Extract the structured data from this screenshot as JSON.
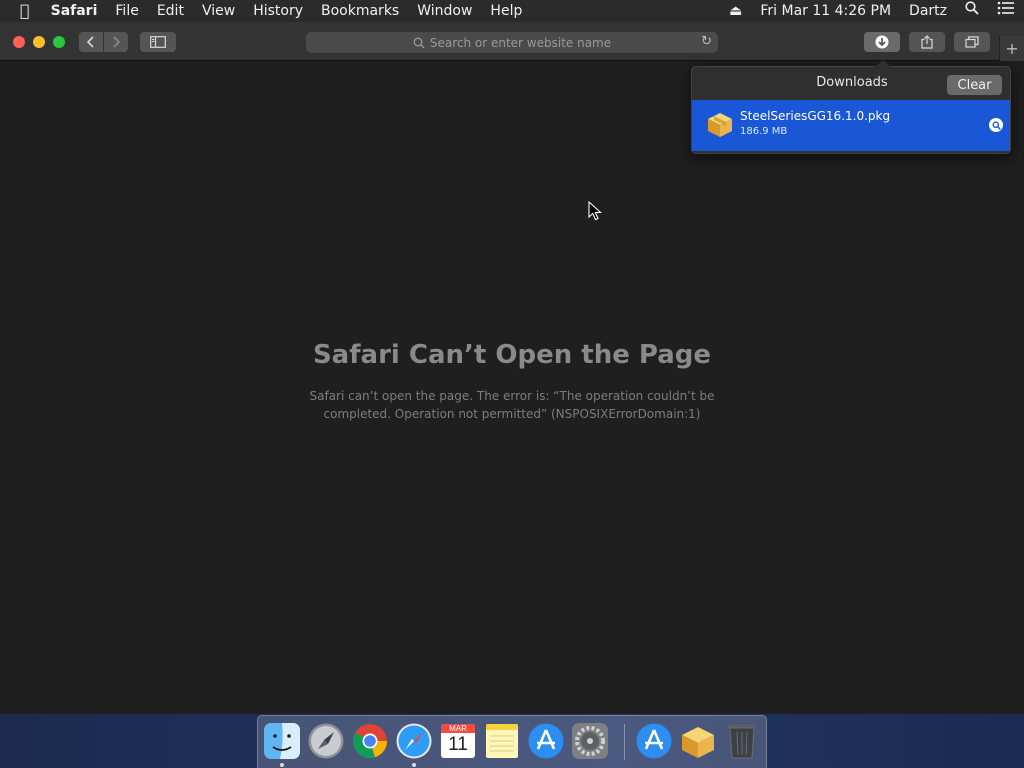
{
  "menubar": {
    "apple": "",
    "app": "Safari",
    "items": [
      "File",
      "Edit",
      "View",
      "History",
      "Bookmarks",
      "Window",
      "Help"
    ],
    "datetime": "Fri Mar 11  4:26 PM",
    "user": "Dartz"
  },
  "toolbar": {
    "address_placeholder": "Search or enter website name"
  },
  "error": {
    "title": "Safari Can’t Open the Page",
    "message": "Safari can’t open the page. The error is: “The operation couldn’t be completed. Operation not permitted” (NSPOSIXErrorDomain:1)"
  },
  "downloads": {
    "title": "Downloads",
    "clear_label": "Clear",
    "items": [
      {
        "name": "SteelSeriesGG16.1.0.pkg",
        "size": "186.9 MB",
        "icon": "package-icon"
      }
    ]
  },
  "calendar_icon": {
    "month": "MAR",
    "day": "11"
  },
  "dock": {
    "apps": [
      "Finder",
      "Launchpad",
      "Chrome",
      "Safari",
      "Calendar",
      "Notes",
      "App Store",
      "System Preferences",
      "Downloads App Store",
      "Package",
      "Trash"
    ]
  },
  "colors": {
    "selection": "#1a57d6",
    "close": "#fe5f57",
    "minimize": "#febc2e",
    "zoom": "#28c840"
  }
}
